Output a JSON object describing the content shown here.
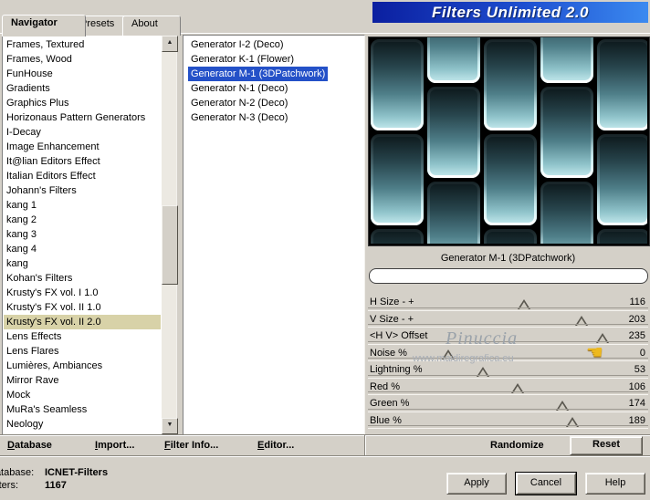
{
  "window": {
    "title": "Filters Unlimited 2.0"
  },
  "tabs": [
    {
      "label": "Navigator",
      "active": true
    },
    {
      "label": "Presets",
      "active": false
    },
    {
      "label": "About",
      "active": false
    }
  ],
  "icons": {
    "scroll_up": "▲",
    "scroll_down": "▼",
    "hand": "☚"
  },
  "colors": {
    "title_gradient_start": "#0b1fa0",
    "title_gradient_end": "#3b8af0",
    "category_selected_bg": "#d8d2a8",
    "filter_selected_bg": "#2451c8",
    "preview_dark": "#0c171a",
    "preview_teal": "#4f7f89",
    "preview_glow": "#d2f2f5",
    "dialog_bg": "#d4d0c8"
  },
  "category_list": {
    "items": [
      "Frames, Textured",
      "Frames, Wood",
      "FunHouse",
      "Gradients",
      "Graphics Plus",
      "Horizonaus Pattern Generators",
      "I-Decay",
      "Image Enhancement",
      "It@lian Editors Effect",
      "Italian Editors Effect",
      "Johann's Filters",
      "kang 1",
      "kang 2",
      "kang 3",
      "kang 4",
      "kang",
      "Kohan's Filters",
      "Krusty's FX vol. I 1.0",
      "Krusty's FX vol. II 1.0",
      "Krusty's FX vol. II 2.0",
      "Lens Effects",
      "Lens Flares",
      "Lumières, Ambiances",
      "Mirror Rave",
      "Mock",
      "MuRa's Seamless",
      "Neology"
    ],
    "selected": "Krusty's FX vol. II 2.0"
  },
  "filter_list": {
    "items": [
      "Generator I-2 (Deco)",
      "Generator K-1 (Flower)",
      "Generator M-1 (3DPatchwork)",
      "Generator N-1 (Deco)",
      "Generator N-2 (Deco)",
      "Generator N-3 (Deco)"
    ],
    "selected": "Generator M-1 (3DPatchwork)"
  },
  "preview": {
    "caption": "Generator M-1 (3DPatchwork)"
  },
  "sliders": [
    {
      "label": "H Size - +",
      "value": 116,
      "max": 255
    },
    {
      "label": "V Size - +",
      "value": 203,
      "max": 255
    },
    {
      "label": "<H V> Offset",
      "value": 235,
      "max": 255
    },
    {
      "label": "Noise %",
      "value": 0,
      "max": 255
    },
    {
      "label": "Lightning %",
      "value": 53,
      "max": 255
    },
    {
      "label": "Red %",
      "value": 106,
      "max": 255
    },
    {
      "label": "Green %",
      "value": 174,
      "max": 255
    },
    {
      "label": "Blue %",
      "value": 189,
      "max": 255
    }
  ],
  "watermark": {
    "name": "Pinuccia",
    "site": "www.maidiregrafica.eu"
  },
  "toolbar": {
    "database": {
      "u": "D",
      "rest": "atabase"
    },
    "import": {
      "u": "I",
      "rest": "mport..."
    },
    "filter_info": {
      "u": "F",
      "rest": "ilter Info..."
    },
    "editor": {
      "u": "E",
      "rest": "ditor..."
    },
    "randomize": "Randomize",
    "reset": "Reset"
  },
  "status": {
    "database_label": "Database:",
    "database_value": "ICNET-Filters",
    "filters_label": "Filters:",
    "filters_value": "1167"
  },
  "buttons": {
    "apply": "Apply",
    "cancel": "Cancel",
    "help": "Help"
  }
}
